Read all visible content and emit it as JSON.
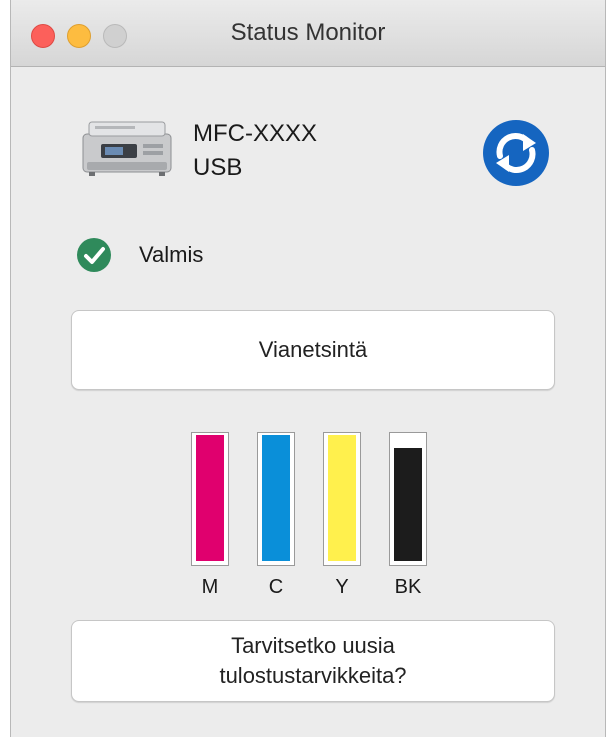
{
  "window": {
    "title": "Status Monitor"
  },
  "device": {
    "model": "MFC-XXXX",
    "connection": "USB",
    "icon": "printer-icon"
  },
  "refresh": {
    "icon": "refresh-icon",
    "color": "#1565c0"
  },
  "status": {
    "text": "Valmis",
    "icon": "checkmark-icon",
    "color": "#2f8a5b"
  },
  "buttons": {
    "troubleshoot": "Vianetsintä",
    "supplies_line1": "Tarvitsetko uusia",
    "supplies_line2": "tulostustarvikkeita?"
  },
  "inks": [
    {
      "label": "M",
      "color": "#e0006e",
      "level": 1.0
    },
    {
      "label": "C",
      "color": "#0a8fd9",
      "level": 1.0
    },
    {
      "label": "Y",
      "color": "#fff04d",
      "level": 1.0
    },
    {
      "label": "BK",
      "color": "#1c1c1c",
      "level": 0.9
    }
  ]
}
